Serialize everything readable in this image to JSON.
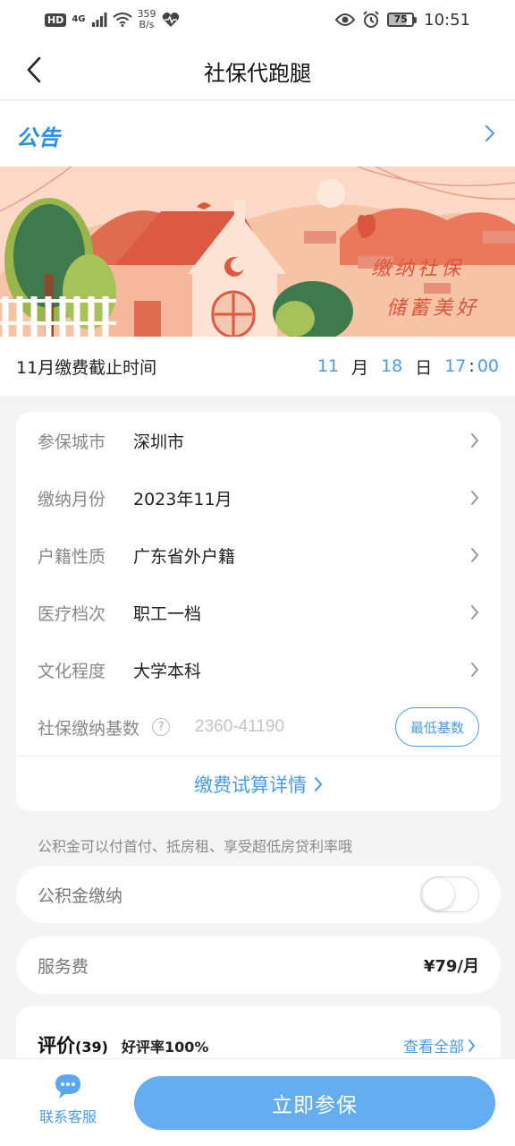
{
  "status_bar": {
    "hd": "HD",
    "network": "4G",
    "speed_value": "359",
    "speed_unit": "B/s",
    "battery": "75",
    "time": "10:51"
  },
  "header": {
    "title": "社保代跑腿",
    "back_icon": "chevron-left-icon"
  },
  "notice": {
    "label": "公告",
    "arrow_icon": "chevron-right-icon"
  },
  "banner": {
    "line1": "缴纳社保",
    "line2": "储蓄美好"
  },
  "deadline": {
    "label": "11月缴费截止时间",
    "month": "11",
    "month_unit": "月",
    "day": "18",
    "day_unit": "日",
    "hour": "17",
    "separator": ":",
    "minute": "00"
  },
  "form": {
    "rows": [
      {
        "label": "参保城市",
        "value": "深圳市"
      },
      {
        "label": "缴纳月份",
        "value": "2023年11月"
      },
      {
        "label": "户籍性质",
        "value": "广东省外户籍"
      },
      {
        "label": "医疗档次",
        "value": "职工一档"
      },
      {
        "label": "文化程度",
        "value": "大学本科"
      }
    ],
    "base_label": "社保缴纳基数",
    "base_help": "?",
    "base_placeholder": "2360-41190",
    "base_value": "",
    "min_base_button": "最低基数",
    "calc_link": "缴费试算详情"
  },
  "hint": "公积金可以付首付、抵房租、享受超低房贷利率哦",
  "provident_fund": {
    "label": "公积金缴纳",
    "enabled": false
  },
  "service_fee": {
    "label": "服务费",
    "value": "¥79/月"
  },
  "reviews": {
    "title": "评价",
    "count": "(39)",
    "rate": "好评率100%",
    "view_all": "查看全部"
  },
  "bottom_bar": {
    "customer_service": "联系客服",
    "enroll_button": "立即参保"
  },
  "colors": {
    "accent": "#4a9be0",
    "button": "#64adf0",
    "banner_red": "#d9573e",
    "background": "#f4f4f5"
  }
}
